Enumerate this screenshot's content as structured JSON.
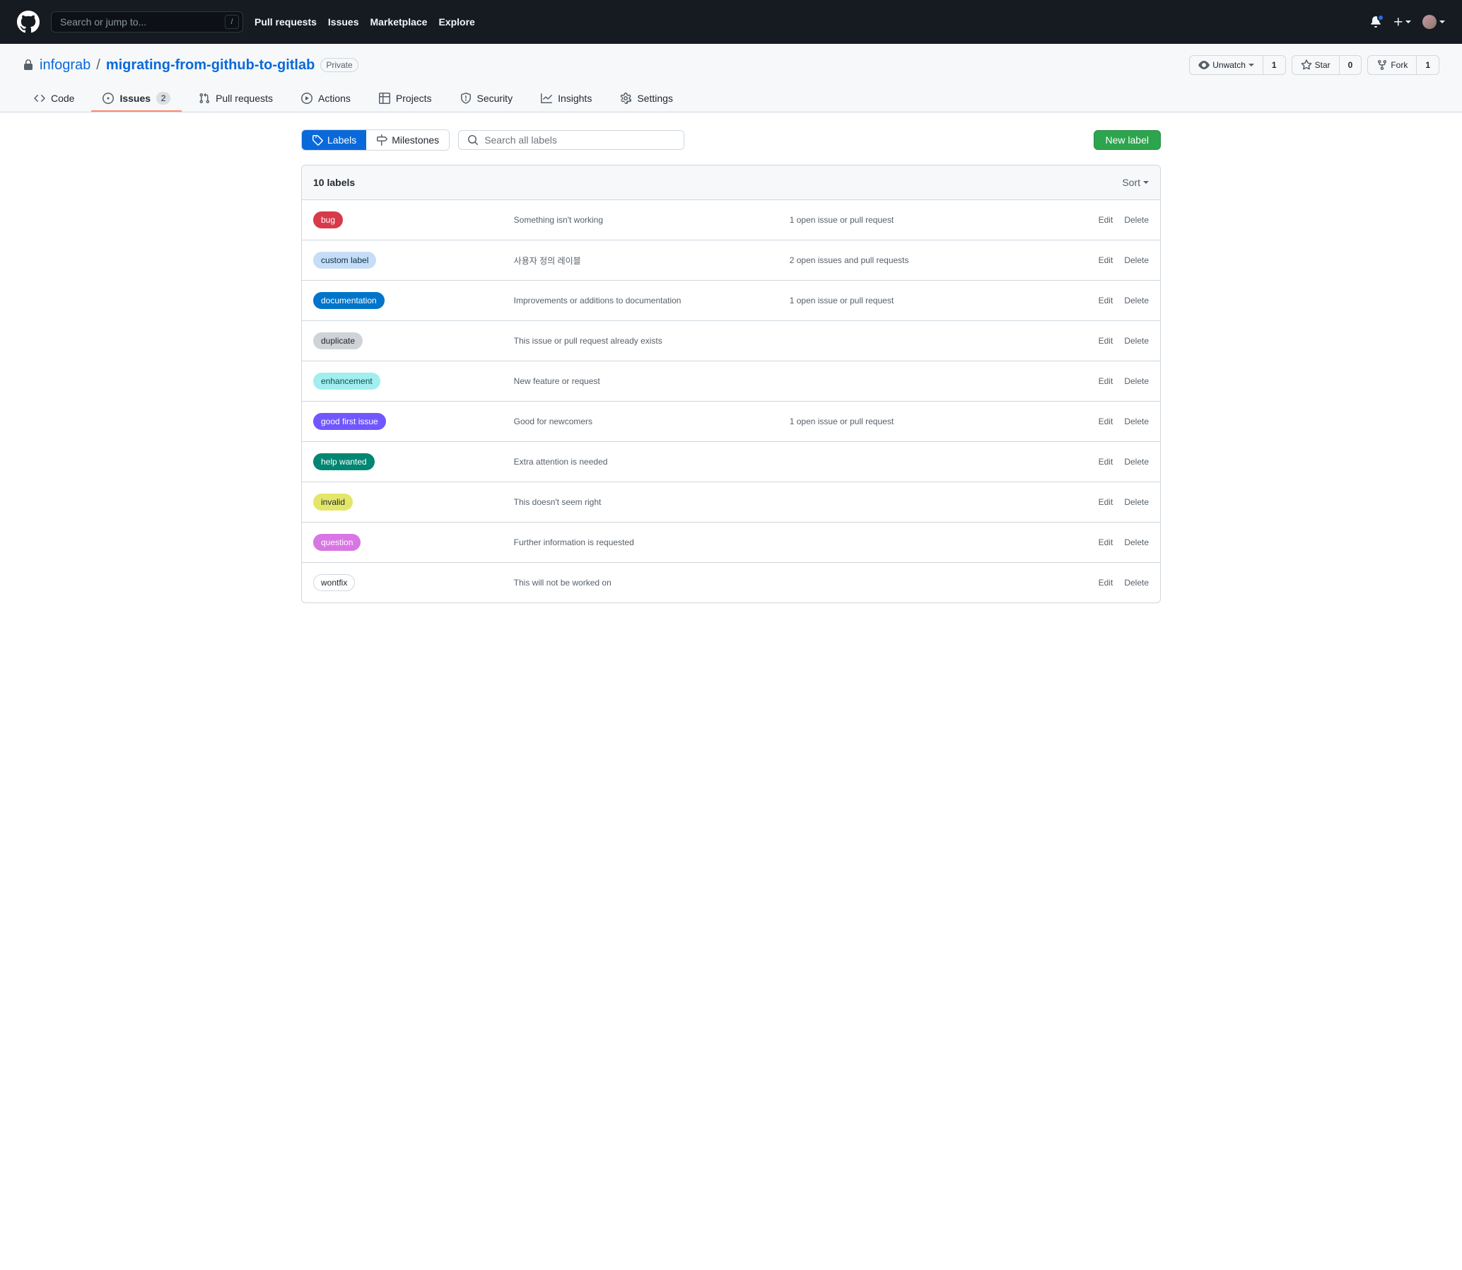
{
  "nav": {
    "search_placeholder": "Search or jump to...",
    "slash": "/",
    "links": [
      "Pull requests",
      "Issues",
      "Marketplace",
      "Explore"
    ]
  },
  "repo": {
    "owner": "infograb",
    "name": "migrating-from-github-to-gitlab",
    "visibility": "Private",
    "actions": {
      "unwatch": "Unwatch",
      "unwatch_count": "1",
      "star": "Star",
      "star_count": "0",
      "fork": "Fork",
      "fork_count": "1"
    }
  },
  "tabs": {
    "code": "Code",
    "issues": "Issues",
    "issues_count": "2",
    "pulls": "Pull requests",
    "actions": "Actions",
    "projects": "Projects",
    "security": "Security",
    "insights": "Insights",
    "settings": "Settings"
  },
  "subnav": {
    "labels": "Labels",
    "milestones": "Milestones",
    "search_placeholder": "Search all labels",
    "new_label": "New label"
  },
  "labels_header": {
    "title": "10 labels",
    "sort": "Sort"
  },
  "row_actions": {
    "edit": "Edit",
    "delete": "Delete"
  },
  "labels": [
    {
      "name": "bug",
      "bg": "#d73a4a",
      "fg": "#fff",
      "border": "#d73a4a",
      "desc": "Something isn't working",
      "count": "1 open issue or pull request"
    },
    {
      "name": "custom label",
      "bg": "#c5def5",
      "fg": "#0b2e4f",
      "border": "#c5def5",
      "desc": "사용자 정의 레이블",
      "count": "2 open issues and pull requests"
    },
    {
      "name": "documentation",
      "bg": "#0075ca",
      "fg": "#fff",
      "border": "#0075ca",
      "desc": "Improvements or additions to documentation",
      "count": "1 open issue or pull request"
    },
    {
      "name": "duplicate",
      "bg": "#cfd3d7",
      "fg": "#24292f",
      "border": "#cfd3d7",
      "desc": "This issue or pull request already exists",
      "count": ""
    },
    {
      "name": "enhancement",
      "bg": "#a2eeef",
      "fg": "#0b4f53",
      "border": "#a2eeef",
      "desc": "New feature or request",
      "count": ""
    },
    {
      "name": "good first issue",
      "bg": "#7057ff",
      "fg": "#fff",
      "border": "#7057ff",
      "desc": "Good for newcomers",
      "count": "1 open issue or pull request"
    },
    {
      "name": "help wanted",
      "bg": "#008672",
      "fg": "#fff",
      "border": "#008672",
      "desc": "Extra attention is needed",
      "count": ""
    },
    {
      "name": "invalid",
      "bg": "#e4e669",
      "fg": "#24292f",
      "border": "#e4e669",
      "desc": "This doesn't seem right",
      "count": ""
    },
    {
      "name": "question",
      "bg": "#d876e3",
      "fg": "#fff",
      "border": "#d876e3",
      "desc": "Further information is requested",
      "count": ""
    },
    {
      "name": "wontfix",
      "bg": "#ffffff",
      "fg": "#24292f",
      "border": "#d0d7de",
      "desc": "This will not be worked on",
      "count": ""
    }
  ]
}
